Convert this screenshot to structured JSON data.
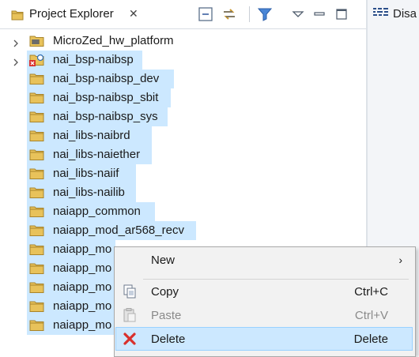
{
  "tabs": {
    "project_explorer": {
      "label": "Project Explorer",
      "close_glyph": "✕"
    },
    "right_tab": {
      "label": "Disa"
    }
  },
  "toolbar": {
    "icons": [
      "collapse-all-icon",
      "link-with-editor-icon",
      "filter-icon",
      "view-menu-icon",
      "minimize-icon",
      "maximize-icon"
    ]
  },
  "tree": {
    "items": [
      {
        "label": "MicroZed_hw_platform",
        "icon": "hw-platform-icon",
        "expandable": true,
        "selected": false,
        "highlight_width": 0
      },
      {
        "label": "nai_bsp-naibsp",
        "icon": "bsp-error-icon",
        "expandable": true,
        "selected": true
      },
      {
        "label": "nai_bsp-naibsp_dev",
        "icon": "folder-icon",
        "expandable": false,
        "selected": true
      },
      {
        "label": "nai_bsp-naibsp_sbit",
        "icon": "folder-icon",
        "expandable": false,
        "selected": true
      },
      {
        "label": "nai_bsp-naibsp_sys",
        "icon": "folder-icon",
        "expandable": false,
        "selected": true
      },
      {
        "label": "nai_libs-naibrd",
        "icon": "folder-icon",
        "expandable": false,
        "selected": true
      },
      {
        "label": "nai_libs-naiether",
        "icon": "folder-icon",
        "expandable": false,
        "selected": true
      },
      {
        "label": "nai_libs-naiif",
        "icon": "folder-icon",
        "expandable": false,
        "selected": true
      },
      {
        "label": "nai_libs-nailib",
        "icon": "folder-icon",
        "expandable": false,
        "selected": true
      },
      {
        "label": "naiapp_common",
        "icon": "folder-icon",
        "expandable": false,
        "selected": true
      },
      {
        "label": "naiapp_mod_ar568_recv",
        "icon": "folder-icon",
        "expandable": false,
        "selected": true
      },
      {
        "label": "naiapp_mo",
        "icon": "folder-icon",
        "expandable": false,
        "selected": true
      },
      {
        "label": "naiapp_mo",
        "icon": "folder-icon",
        "expandable": false,
        "selected": true
      },
      {
        "label": "naiapp_mo",
        "icon": "folder-icon",
        "expandable": false,
        "selected": true
      },
      {
        "label": "naiapp_mo",
        "icon": "folder-icon",
        "expandable": false,
        "selected": true
      },
      {
        "label": "naiapp_mo",
        "icon": "folder-icon",
        "expandable": false,
        "selected": true
      }
    ]
  },
  "context_menu": {
    "new": {
      "label": "New",
      "submenu_glyph": "›"
    },
    "copy": {
      "label": "Copy",
      "shortcut": "Ctrl+C",
      "icon": "copy-icon"
    },
    "paste": {
      "label": "Paste",
      "shortcut": "Ctrl+V",
      "icon": "paste-icon",
      "disabled": true
    },
    "delete": {
      "label": "Delete",
      "shortcut": "Delete",
      "icon": "delete-icon",
      "active": true
    }
  },
  "colors": {
    "selection": "#cce8ff",
    "folder": "#e8c25a",
    "delete_red": "#d9302c",
    "accent": "#1e6fd0"
  }
}
